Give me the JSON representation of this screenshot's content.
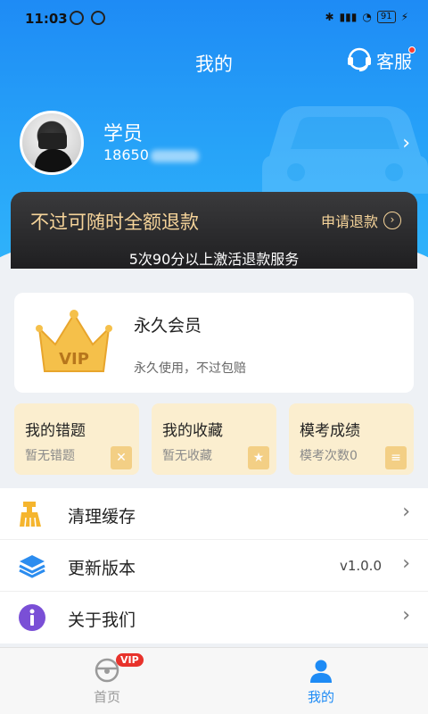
{
  "status_bar": {
    "time": "11:03",
    "battery": "91"
  },
  "header": {
    "title": "我的",
    "service_label": "客服"
  },
  "profile": {
    "name": "学员",
    "phone": "18650"
  },
  "refund_banner": {
    "headline": "不过可随时全额退款",
    "apply_label": "申请退款",
    "subtitle": "5次90分以上激活退款服务"
  },
  "vip_card": {
    "badge": "VIP",
    "title": "永久会员",
    "description": "永久使用，不过包赔"
  },
  "tiles": [
    {
      "title": "我的错题",
      "subtitle": "暂无错题"
    },
    {
      "title": "我的收藏",
      "subtitle": "暂无收藏"
    },
    {
      "title": "模考成绩",
      "subtitle": "模考次数0"
    }
  ],
  "menu": [
    {
      "label": "清理缓存",
      "value": ""
    },
    {
      "label": "更新版本",
      "value": "v1.0.0"
    },
    {
      "label": "关于我们",
      "value": ""
    }
  ],
  "tabbar": {
    "home_label": "首页",
    "home_badge": "VIP",
    "mine_label": "我的",
    "active_color": "#1e8bf5",
    "inactive_color": "#999999"
  }
}
